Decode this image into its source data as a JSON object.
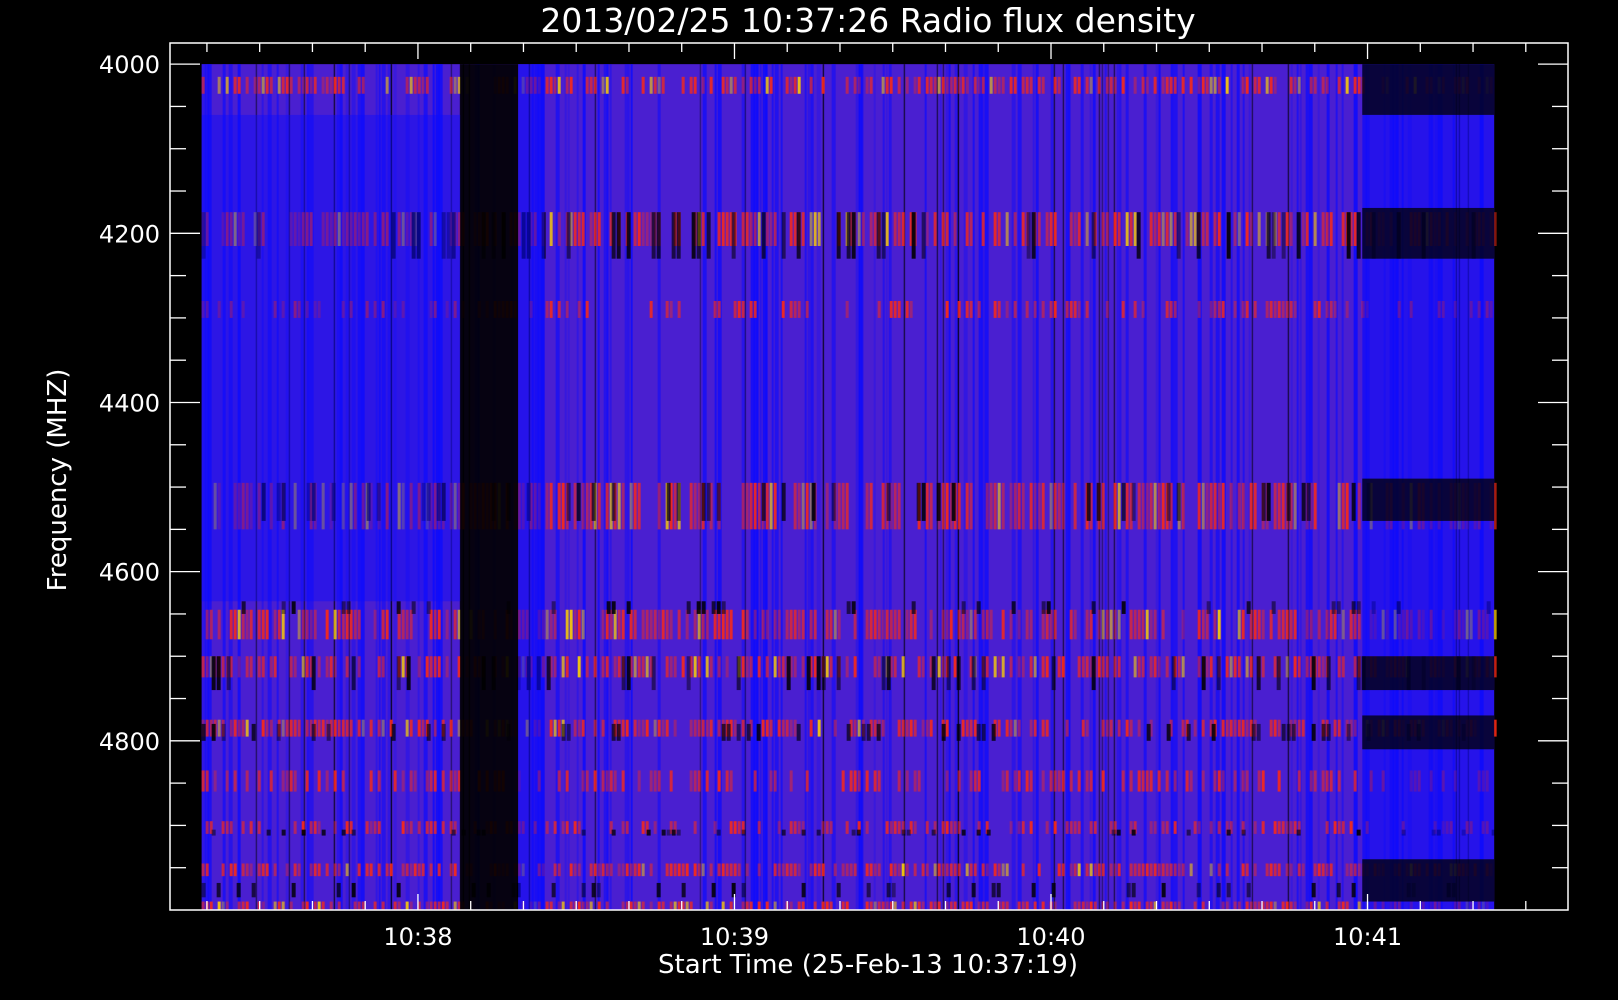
{
  "chart_data": {
    "type": "heatmap",
    "title": "2013/02/25 10:37:26 Radio flux density",
    "xlabel": "Start Time (25-Feb-13 10:37:19)",
    "ylabel": "Frequency (MHZ)",
    "x_ticks": [
      {
        "label": "10:38",
        "time": "10:38:00"
      },
      {
        "label": "10:39",
        "time": "10:39:00"
      },
      {
        "label": "10:40",
        "time": "10:40:00"
      },
      {
        "label": "10:41",
        "time": "10:41:00"
      }
    ],
    "y_ticks": [
      {
        "label": "4000",
        "value": 4000
      },
      {
        "label": "4200",
        "value": 4200
      },
      {
        "label": "4400",
        "value": 4400
      },
      {
        "label": "4600",
        "value": 4600
      },
      {
        "label": "4800",
        "value": 4800
      }
    ],
    "x_range": [
      "10:37:13",
      "10:41:38"
    ],
    "data_time_range": [
      "10:37:19",
      "10:41:24"
    ],
    "y_range": [
      3975,
      5000
    ],
    "data_freq_range": [
      4000,
      5000
    ],
    "y_inverted": true,
    "colormap": [
      "#000000",
      "#0a0aff",
      "#4a1fd0",
      "#7a2aa8",
      "#ff2a10",
      "#ffd000"
    ],
    "background_level": "#4a1fd0",
    "bright_bands_mhz": [
      {
        "from": 4015,
        "to": 4035,
        "level": "high"
      },
      {
        "from": 4175,
        "to": 4215,
        "level": "high"
      },
      {
        "from": 4280,
        "to": 4300,
        "level": "medium"
      },
      {
        "from": 4495,
        "to": 4550,
        "level": "high"
      },
      {
        "from": 4645,
        "to": 4680,
        "level": "high"
      },
      {
        "from": 4700,
        "to": 4725,
        "level": "high"
      },
      {
        "from": 4775,
        "to": 4795,
        "level": "high"
      },
      {
        "from": 4835,
        "to": 4860,
        "level": "medium"
      },
      {
        "from": 4895,
        "to": 4910,
        "level": "medium"
      },
      {
        "from": 4945,
        "to": 4960,
        "level": "high"
      },
      {
        "from": 4990,
        "to": 5000,
        "level": "high"
      }
    ],
    "dark_time_spans": [
      {
        "from": "10:38:08",
        "to": "10:38:19"
      },
      {
        "from": "10:40:59",
        "to": "10:41:24"
      }
    ],
    "grid": false
  }
}
